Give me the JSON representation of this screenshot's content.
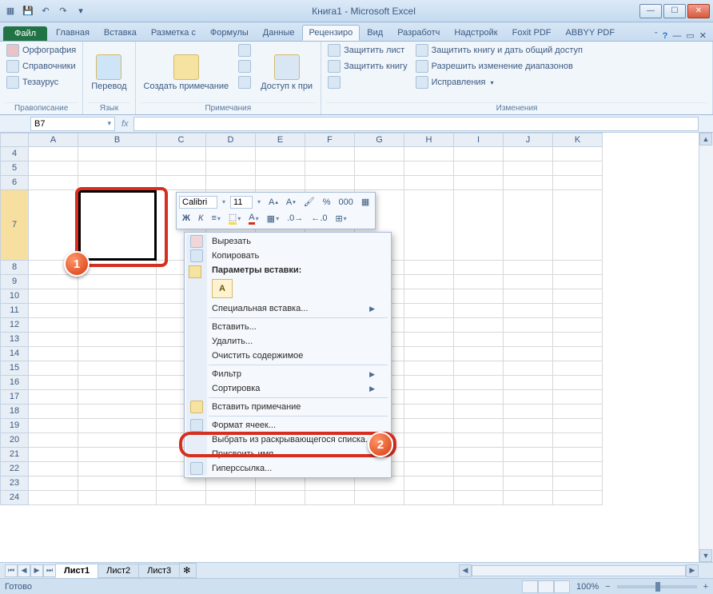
{
  "title": "Книга1 - Microsoft Excel",
  "ribbon_tabs": {
    "file": "Файл",
    "t0": "Главная",
    "t1": "Вставка",
    "t2": "Разметка с",
    "t3": "Формулы",
    "t4": "Данные",
    "t5": "Рецензиро",
    "t6": "Вид",
    "t7": "Разработч",
    "t8": "Надстройк",
    "t9": "Foxit PDF",
    "t10": "ABBYY PDF"
  },
  "ribbon": {
    "g_proof": {
      "label": "Правописание",
      "spelling": "Орфография",
      "research": "Справочники",
      "thesaurus": "Тезаурус"
    },
    "g_lang": {
      "label": "Язык",
      "translate": "Перевод"
    },
    "g_comment": {
      "label": "Примечания",
      "new": "Создать примечание",
      "access": "Доступ к при"
    },
    "g_changes": {
      "label": "Изменения",
      "protect_sheet": "Защитить лист",
      "protect_book": "Защитить книгу",
      "share_book": "Защитить книгу и дать общий доступ",
      "allow_ranges": "Разрешить изменение диапазонов",
      "track": "Исправления"
    }
  },
  "namebox": "B7",
  "cols": [
    "A",
    "B",
    "C",
    "D",
    "E",
    "F",
    "G",
    "H",
    "I",
    "J",
    "K"
  ],
  "rows": [
    "4",
    "5",
    "6",
    "7",
    "8",
    "9",
    "10",
    "11",
    "12",
    "13",
    "14",
    "15",
    "16",
    "17",
    "18",
    "19",
    "20",
    "21",
    "22",
    "23",
    "24"
  ],
  "minitoolbar": {
    "font": "Calibri",
    "size": "11",
    "bold": "Ж",
    "italic": "К"
  },
  "context_menu": {
    "cut": "Вырезать",
    "copy": "Копировать",
    "paste_header": "Параметры вставки:",
    "paste_special": "Специальная вставка...",
    "insert": "Вставить...",
    "delete": "Удалить...",
    "clear": "Очистить содержимое",
    "filter": "Фильтр",
    "sort": "Сортировка",
    "insert_comment": "Вставить примечание",
    "format_cells": "Формат ячеек...",
    "dropdown_list": "Выбрать из раскрывающегося списка...",
    "define_name": "Присвоить имя...",
    "hyperlink": "Гиперссылка..."
  },
  "callouts": {
    "c1": "1",
    "c2": "2"
  },
  "sheets": {
    "s1": "Лист1",
    "s2": "Лист2",
    "s3": "Лист3"
  },
  "status": {
    "ready": "Готово",
    "zoom": "100%"
  }
}
